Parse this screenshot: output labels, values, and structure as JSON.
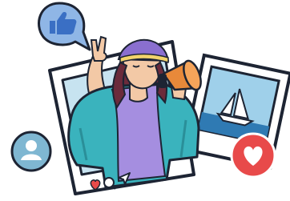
{
  "illustration": {
    "subject": "influencer-with-megaphone",
    "icons": [
      "like-thumb-icon",
      "user-avatar-icon",
      "heart-icon",
      "comment-icon",
      "share-icon",
      "megaphone-icon",
      "sailboat-icon"
    ]
  },
  "colors": {
    "outline": "#1d2433",
    "jacket": "#3ab3bd",
    "jacket_shade": "#2a8f99",
    "top": "#a58ee0",
    "skin": "#f3c9a6",
    "hair": "#6b2b3b",
    "hat": "#8a6fcf",
    "megaphone": "#e8893a",
    "frame_bg": "#c7e3f0",
    "like_bubble": "#8fb6e6",
    "like_thumb": "#3a6fc4",
    "avatar_bg": "#7fb7d2",
    "heart_bg": "#e84a4a",
    "sea": "#2f7ab3",
    "sky": "#9fd0ea"
  }
}
